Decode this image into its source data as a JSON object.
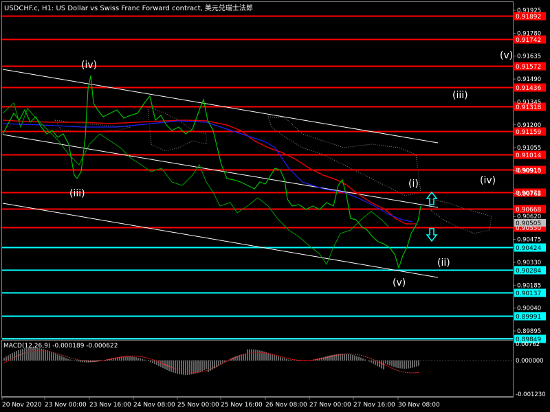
{
  "chart_title": "USDCHF.c, H1:  US Dollar vs Swiss Franc Forward contract, 美元兑瑞士法郎",
  "macd": {
    "label": "MACD(12,26,9)",
    "main_value": "-0.000189",
    "signal_value": "-0.000622",
    "ticks": [
      "0.00762",
      "0.000000",
      "-0.001230"
    ]
  },
  "chart_data": {
    "type": "line",
    "price_axis_ticks": [
      "0.91925",
      "0.91780",
      "0.91635",
      "0.91490",
      "0.91345",
      "0.91200",
      "0.91055",
      "0.90910",
      "0.90765",
      "0.90620",
      "0.90475",
      "0.90330",
      "0.90185",
      "0.90040",
      "0.89895"
    ],
    "time_axis_ticks": [
      "20 Nov 2020",
      "23 Nov 00:00",
      "23 Nov 16:00",
      "24 Nov 08:00",
      "25 Nov 00:00",
      "25 Nov 16:00",
      "26 Nov 08:00",
      "27 Nov 00:00",
      "27 Nov 16:00",
      "30 Nov 08:00"
    ],
    "current_price": "0.90505",
    "red_levels": [
      {
        "label": "0.91892",
        "value": 0.91892
      },
      {
        "label": "0.91742",
        "value": 0.91742
      },
      {
        "label": "0.91572",
        "value": 0.91572
      },
      {
        "label": "0.91436",
        "value": 0.91436
      },
      {
        "label": "0.91318",
        "value": 0.91318
      },
      {
        "label": "0.91159",
        "value": 0.91159
      },
      {
        "label": "0.91014",
        "value": 0.91014
      },
      {
        "label": "0.90915",
        "value": 0.90915
      },
      {
        "label": "0.90772",
        "value": 0.90772
      },
      {
        "label": "0.90668",
        "value": 0.90668
      },
      {
        "label": "0.90550",
        "value": 0.9055
      }
    ],
    "cyan_levels": [
      {
        "label": "0.90424",
        "value": 0.90424
      },
      {
        "label": "0.90284",
        "value": 0.90284
      },
      {
        "label": "0.90137",
        "value": 0.90137
      },
      {
        "label": "0.89991",
        "value": 0.89991
      },
      {
        "label": "0.89849",
        "value": 0.89849
      }
    ],
    "wave_labels": [
      "(iv)",
      "(iii)",
      "(iii)",
      "(v)",
      "(iv)",
      "(i)",
      "(v)",
      "(ii)"
    ],
    "colors": {
      "price": "#00c000",
      "red_line": "#ff0000",
      "cyan_line": "#00ffff",
      "ma_red": "#e00000",
      "ma_blue": "#2020ff",
      "channel": "#ffffff",
      "arrow": "#00ffff",
      "macd_hist": "#c8c8c8",
      "macd_signal": "#ff2020"
    }
  }
}
